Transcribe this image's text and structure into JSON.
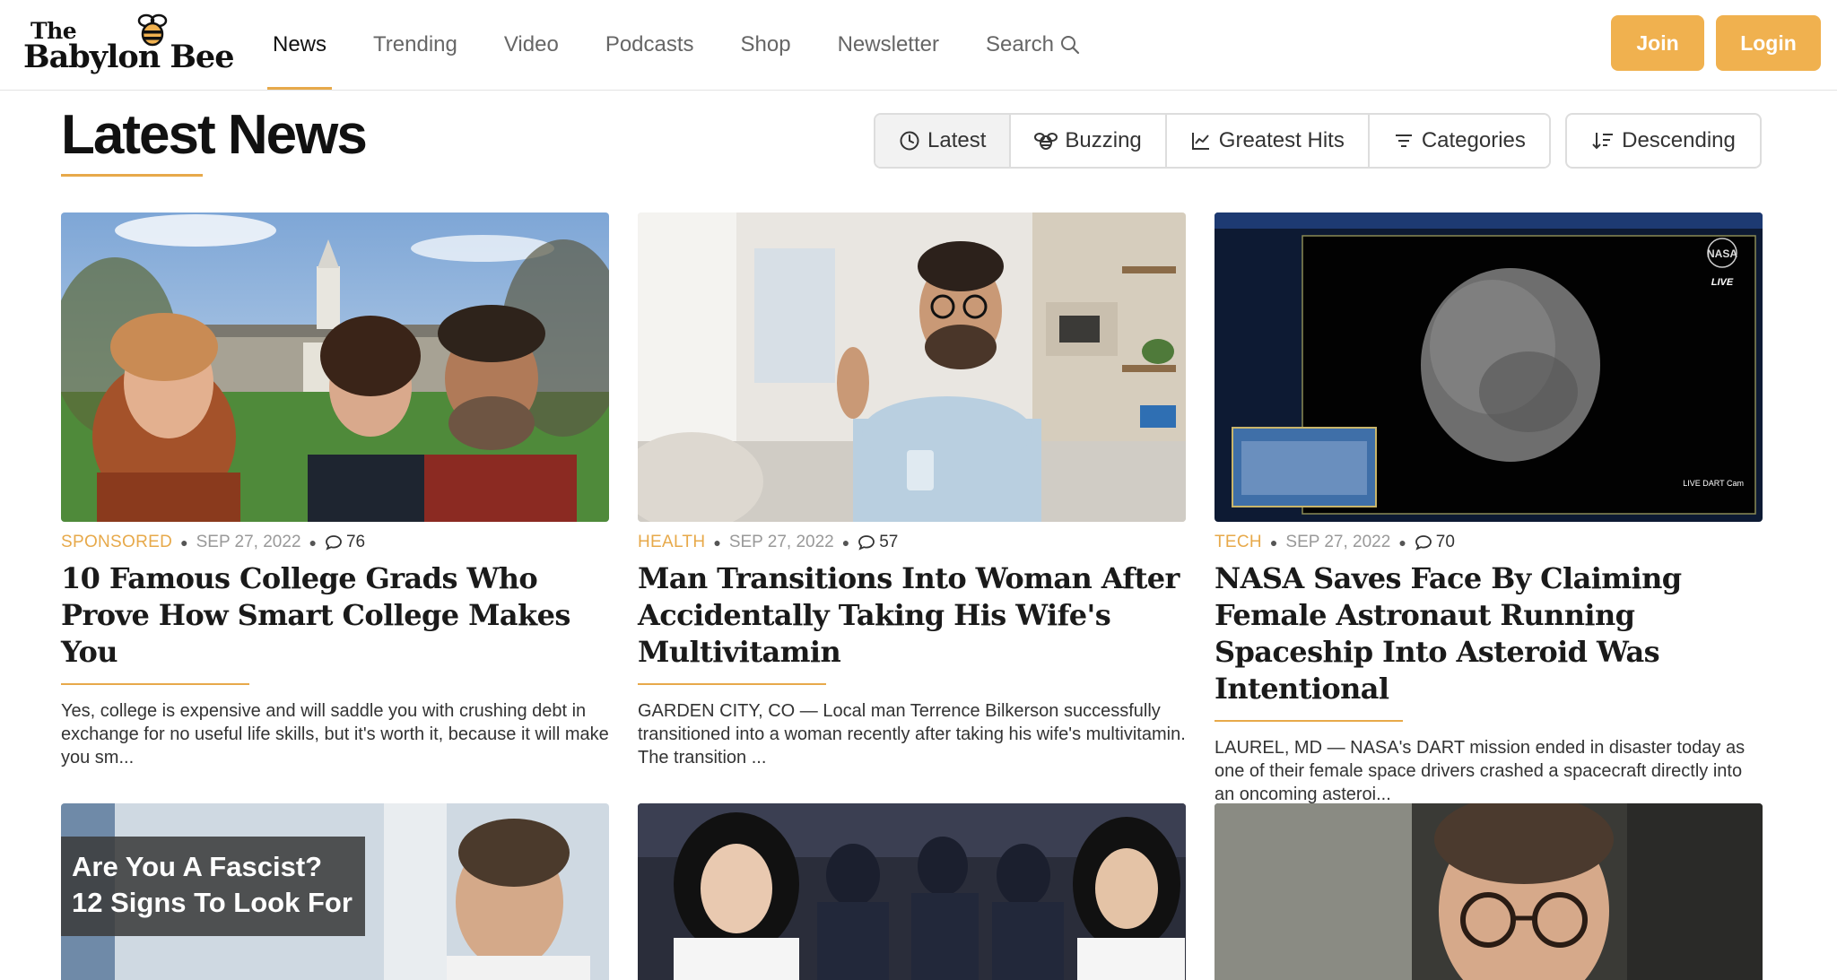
{
  "logo": {
    "line1": "The",
    "line2": "Babylon Bee"
  },
  "nav": {
    "items": [
      {
        "label": "News"
      },
      {
        "label": "Trending"
      },
      {
        "label": "Video"
      },
      {
        "label": "Podcasts"
      },
      {
        "label": "Shop"
      },
      {
        "label": "Newsletter"
      },
      {
        "label": "Search"
      }
    ],
    "active": "News"
  },
  "auth": {
    "join_label": "Join",
    "login_label": "Login"
  },
  "page": {
    "title": "Latest News"
  },
  "filters": {
    "tabs": [
      {
        "label": "Latest",
        "icon": "clock-icon"
      },
      {
        "label": "Buzzing",
        "icon": "bee-icon"
      },
      {
        "label": "Greatest Hits",
        "icon": "chart-icon"
      },
      {
        "label": "Categories",
        "icon": "filter-icon"
      }
    ],
    "active": "Latest",
    "sort_label": "Descending"
  },
  "articles": [
    {
      "category": "SPONSORED",
      "date": "SEP 27, 2022",
      "comments": "76",
      "headline": "10 Famous College Grads Who Prove How Smart College Makes You",
      "excerpt": "Yes, college is expensive and will saddle you with crushing debt in exchange for no useful life skills, but it's worth it, because it will make you sm..."
    },
    {
      "category": "HEALTH",
      "date": "SEP 27, 2022",
      "comments": "57",
      "headline": "Man Transitions Into Woman After Accidentally Taking His Wife's Multivitamin",
      "excerpt": "GARDEN CITY, CO — Local man Terrence Bilkerson successfully transitioned into a woman recently after taking his wife's multivitamin. The transition ..."
    },
    {
      "category": "TECH",
      "date": "SEP 27, 2022",
      "comments": "70",
      "headline": "NASA Saves Face By Claiming Female Astronaut Running Spaceship Into Asteroid Was Intentional",
      "excerpt": "LAUREL, MD — NASA's DART mission ended in disaster today as one of their female space drivers crashed a spacecraft directly into an oncoming asteroi..."
    }
  ],
  "second_row": {
    "overlay_line1": "Are You A Fascist?",
    "overlay_line2": "12 Signs To Look For"
  },
  "image_text": {
    "nasa_live": "LIVE",
    "nasa_cam": "LIVE DART Cam",
    "nasa_logo": "NASA"
  },
  "colors": {
    "accent": "#f0b14f",
    "underline": "#e7a94a"
  }
}
